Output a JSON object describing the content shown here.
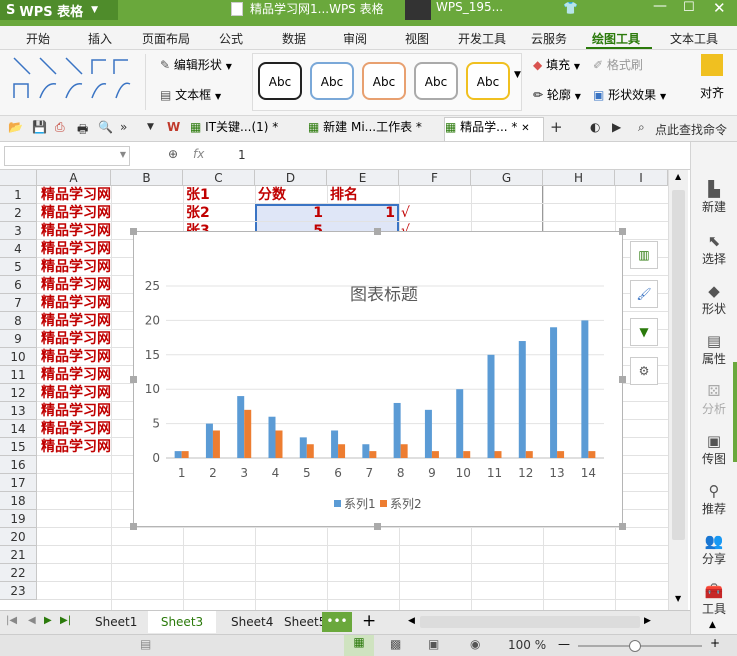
{
  "title_bar": {
    "app_label": "WPS 表格",
    "document_title": "精品学习网1...WPS 表格",
    "user": "WPS_195..."
  },
  "menu": [
    "开始",
    "插入",
    "页面布局",
    "公式",
    "数据",
    "审阅",
    "视图",
    "开发工具",
    "云服务",
    "绘图工具",
    "文本工具"
  ],
  "ribbon": {
    "edit_shape": "编辑形状",
    "text_box": "文本框",
    "shape_styles": [
      "Abc",
      "Abc",
      "Abc",
      "Abc",
      "Abc"
    ],
    "fill": "填充",
    "format_painter": "格式刷",
    "outline": "轮廓",
    "shape_effects": "形状效果",
    "align": "对齐"
  },
  "tabs": [
    "IT关键...(1) *",
    "新建 Mi...工作表 *",
    "精品学... *"
  ],
  "find_command": "点此查找命令",
  "formula": {
    "fx": "fx",
    "value": "1"
  },
  "columns": [
    "A",
    "B",
    "C",
    "D",
    "E",
    "F",
    "G",
    "H",
    "I"
  ],
  "rows": [
    "1",
    "2",
    "3",
    "4",
    "5",
    "6",
    "7",
    "8",
    "9",
    "10",
    "11",
    "12",
    "13",
    "14",
    "15",
    "16",
    "17",
    "18",
    "19",
    "20",
    "21",
    "22",
    "23"
  ],
  "cells": {
    "a_column": [
      "精品学习网",
      "精品学习网",
      "精品学习网",
      "精品学习网",
      "精品学习网",
      "精品学习网",
      "精品学习网",
      "精品学习网",
      "精品学习网",
      "精品学习网",
      "精品学习网",
      "精品学习网",
      "精品学习网",
      "精品学习网",
      "精品学习网"
    ],
    "c1": "张1",
    "c2": "张2",
    "c3": "张3",
    "d1": "分数",
    "e1": "排名",
    "d2": "1",
    "e2": "1",
    "d3": "5",
    "check": "√"
  },
  "chart_data": {
    "type": "bar",
    "title": "图表标题",
    "categories": [
      "1",
      "2",
      "3",
      "4",
      "5",
      "6",
      "7",
      "8",
      "9",
      "10",
      "11",
      "12",
      "13",
      "14"
    ],
    "series": [
      {
        "name": "系列1",
        "color": "#5b9bd5",
        "values": [
          1,
          5,
          9,
          6,
          3,
          4,
          2,
          8,
          7,
          10,
          15,
          17,
          19,
          20
        ]
      },
      {
        "name": "系列2",
        "color": "#ed7d31",
        "values": [
          1,
          4,
          7,
          4,
          2,
          2,
          1,
          2,
          1,
          1,
          1,
          1,
          1,
          1
        ]
      }
    ],
    "ylim": [
      0,
      25
    ],
    "yticks": [
      "0",
      "5",
      "10",
      "15",
      "20",
      "25"
    ],
    "grid": true,
    "legend": "bottom"
  },
  "chart_tools": [
    "layout-icon",
    "brush-icon",
    "filter-icon",
    "gear-icon"
  ],
  "sidebar": [
    "新建",
    "选择",
    "形状",
    "属性",
    "分析",
    "传图",
    "推荐",
    "分享",
    "工具"
  ],
  "sheets": [
    "Sheet1",
    "Sheet3",
    "Sheet4",
    "Sheet5"
  ],
  "sheet_more": "•••",
  "sheet_add": "+",
  "status": {
    "zoom": "100 %"
  },
  "colors": {
    "accent": "#6aa83c",
    "text_red": "#c00000"
  }
}
